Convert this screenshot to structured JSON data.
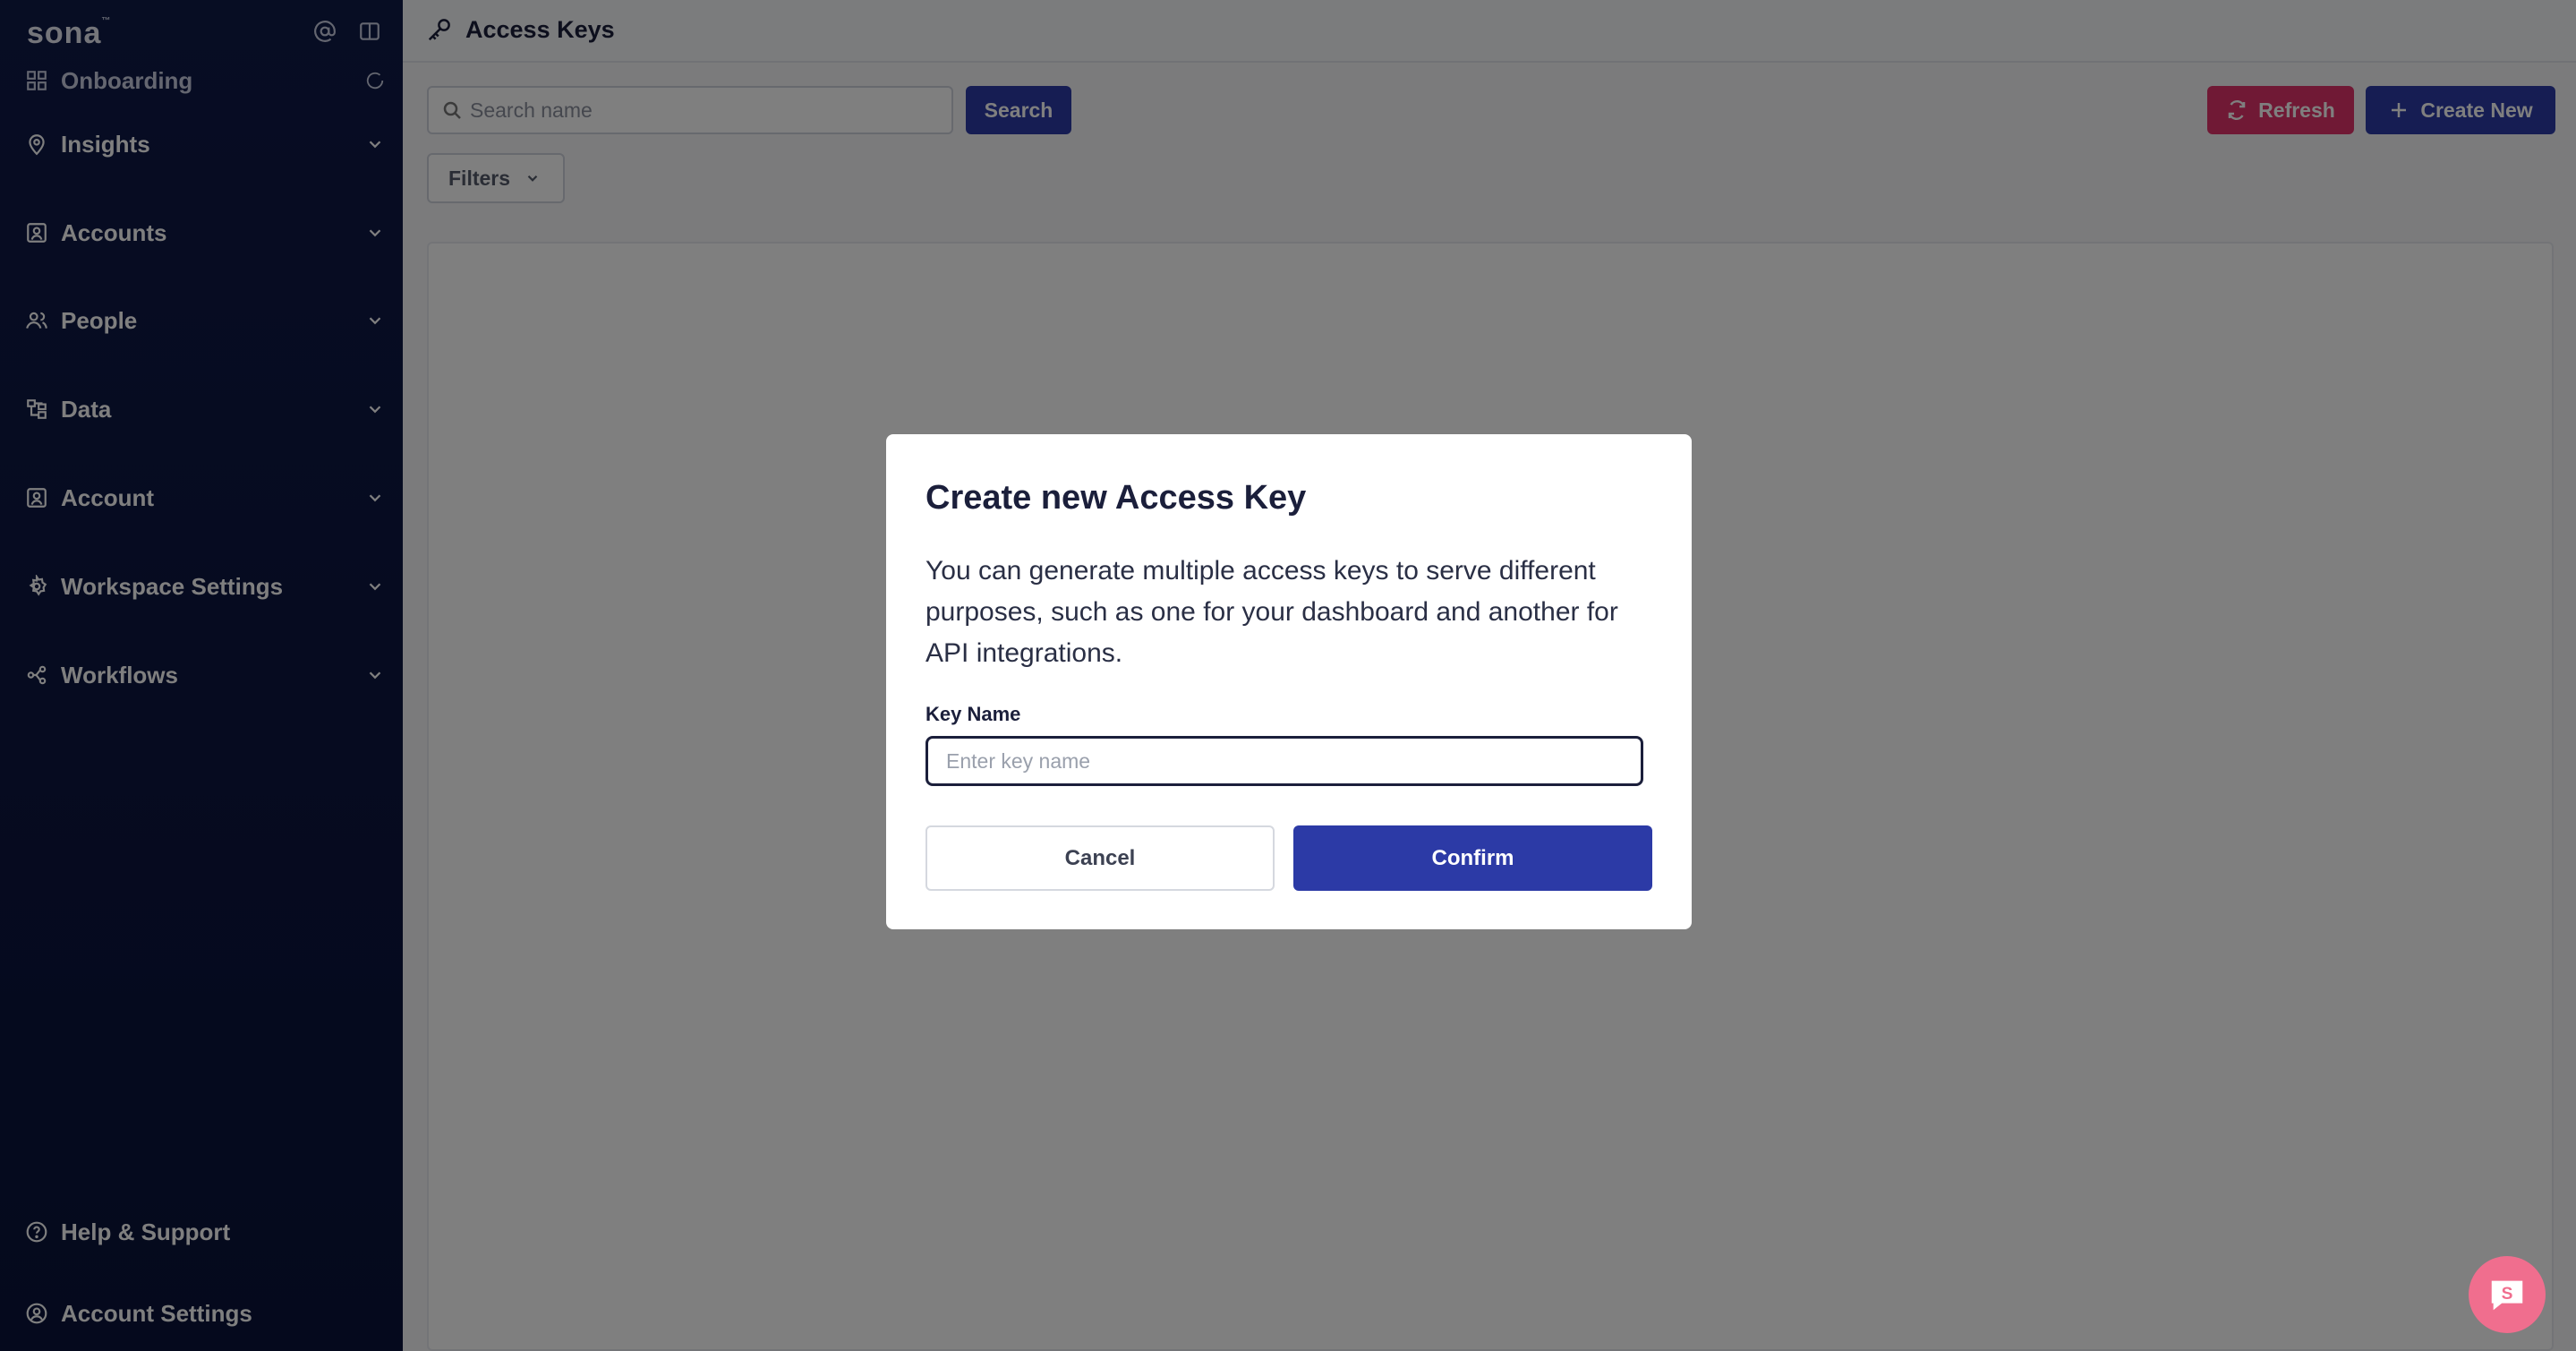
{
  "app": {
    "logo": "sona",
    "logo_mark": "™"
  },
  "sidebar": {
    "top_icons": [
      "at-icon",
      "panel-toggle-icon"
    ],
    "items": [
      {
        "label": "Onboarding",
        "icon": "grid-icon",
        "trailing": "loading-icon"
      },
      {
        "label": "Insights",
        "icon": "map-pin-icon",
        "trailing": "chevron-down-icon"
      },
      {
        "label": "Accounts",
        "icon": "contact-card-icon",
        "trailing": "chevron-down-icon"
      },
      {
        "label": "People",
        "icon": "people-icon",
        "trailing": "chevron-down-icon"
      },
      {
        "label": "Data",
        "icon": "data-flow-icon",
        "trailing": "chevron-down-icon"
      },
      {
        "label": "Account",
        "icon": "contact-card-icon",
        "trailing": "chevron-down-icon"
      },
      {
        "label": "Workspace Settings",
        "icon": "gear-icon",
        "trailing": "chevron-down-icon"
      },
      {
        "label": "Workflows",
        "icon": "workflow-icon",
        "trailing": "chevron-down-icon"
      }
    ],
    "bottom": [
      {
        "label": "Help & Support",
        "icon": "help-circle-icon"
      },
      {
        "label": "Account Settings",
        "icon": "user-circle-icon"
      }
    ]
  },
  "header": {
    "title": "Access Keys",
    "icon": "key-icon"
  },
  "toolbar": {
    "search_placeholder": "Search name",
    "search_label": "Search",
    "refresh_label": "Refresh",
    "create_label": "Create New",
    "filters_label": "Filters"
  },
  "modal": {
    "title": "Create new Access Key",
    "description": "You can generate multiple access keys to serve different purposes, such as one for your dashboard and another for API integrations.",
    "key_name_label": "Key Name",
    "key_name_placeholder": "Enter key name",
    "key_name_value": "",
    "cancel_label": "Cancel",
    "confirm_label": "Confirm"
  },
  "colors": {
    "sidebar_bg": "#0f1a47",
    "primary": "#2c3aa6",
    "danger": "#e0336a",
    "chat": "#f06e8e"
  }
}
